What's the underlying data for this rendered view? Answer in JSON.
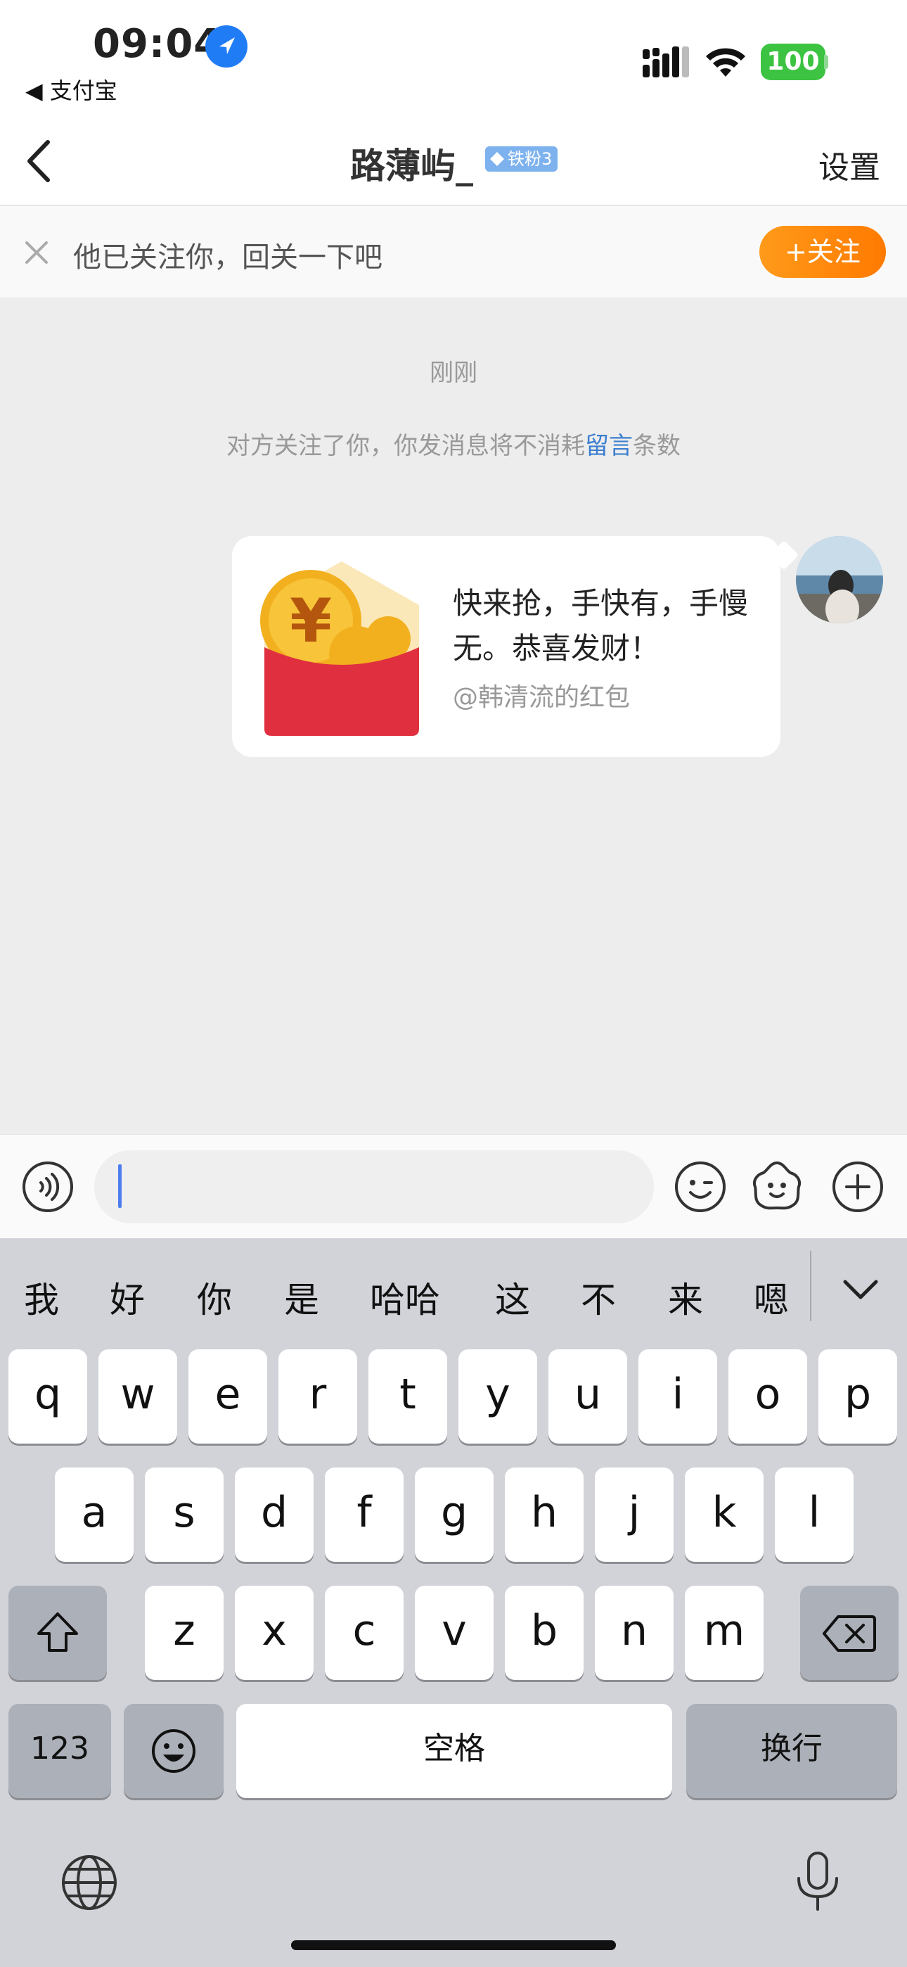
{
  "status_bar": {
    "time": "09:04",
    "back_app": "◀ 支付宝",
    "battery": "100",
    "icons": [
      "location-icon",
      "signal-icon",
      "wifi-icon",
      "battery-icon"
    ]
  },
  "nav": {
    "title": "路薄屿_",
    "badge": "铁粉3",
    "settings": "设置"
  },
  "follow_prompt": {
    "text": "他已关注你，回关一下吧",
    "button": "+关注"
  },
  "chat": {
    "time": "刚刚",
    "notice_prefix": "对方关注了你，你发消息将不消耗",
    "notice_link": "留言",
    "notice_suffix": "条数",
    "red_packet": {
      "message": "快来抢，手快有，手慢无。恭喜发财！",
      "sender": "@韩清流的红包"
    }
  },
  "input": {
    "value": "",
    "placeholder": ""
  },
  "keyboard": {
    "candidates": [
      "我",
      "好",
      "你",
      "是",
      "哈哈",
      "这",
      "不",
      "来",
      "嗯"
    ],
    "row1": [
      "q",
      "w",
      "e",
      "r",
      "t",
      "y",
      "u",
      "i",
      "o",
      "p"
    ],
    "row2": [
      "a",
      "s",
      "d",
      "f",
      "g",
      "h",
      "j",
      "k",
      "l"
    ],
    "row3": [
      "z",
      "x",
      "c",
      "v",
      "b",
      "n",
      "m"
    ],
    "num_key": "123",
    "space": "空格",
    "return": "换行"
  },
  "colors": {
    "accent_orange": "#ff8a00",
    "link_blue": "#3b7fd0",
    "battery_green": "#3cc341",
    "red_packet": "#e0303f"
  }
}
